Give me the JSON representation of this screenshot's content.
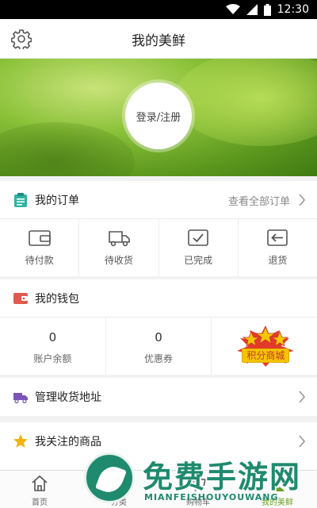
{
  "status_bar": {
    "time": "12:30"
  },
  "header": {
    "title": "我的美鲜",
    "settings_icon": "gear-icon"
  },
  "banner": {
    "login_label": "登录/注册"
  },
  "orders": {
    "title": "我的订单",
    "view_all": "查看全部订单",
    "items": [
      {
        "label": "待付款",
        "icon": "wallet-icon"
      },
      {
        "label": "待收货",
        "icon": "delivery-truck-icon"
      },
      {
        "label": "已完成",
        "icon": "check-box-icon"
      },
      {
        "label": "退货",
        "icon": "return-icon"
      }
    ]
  },
  "wallet": {
    "title": "我的钱包",
    "balance_value": "0",
    "balance_label": "账户余额",
    "coupon_value": "0",
    "coupon_label": "优惠券",
    "points_mall": "积分商城"
  },
  "address": {
    "title": "管理收货地址"
  },
  "favorites": {
    "title": "我关注的商品"
  },
  "tabbar": {
    "items": [
      {
        "label": "首页",
        "icon": "home-icon"
      },
      {
        "label": "分类",
        "icon": "category-icon"
      },
      {
        "label": "购物车",
        "icon": "cart-icon"
      },
      {
        "label": "我的美鲜",
        "icon": "user-icon"
      }
    ]
  },
  "watermark": {
    "big_text": "免费手游网",
    "small_text": "MIANFEISHOUYOUWANG"
  },
  "colors": {
    "accent": "#6a9e1f",
    "orders_icon": "#2fb3a0",
    "wallet_icon": "#e05a4f",
    "address_icon": "#7b55b8",
    "star": "#f2b40a"
  }
}
